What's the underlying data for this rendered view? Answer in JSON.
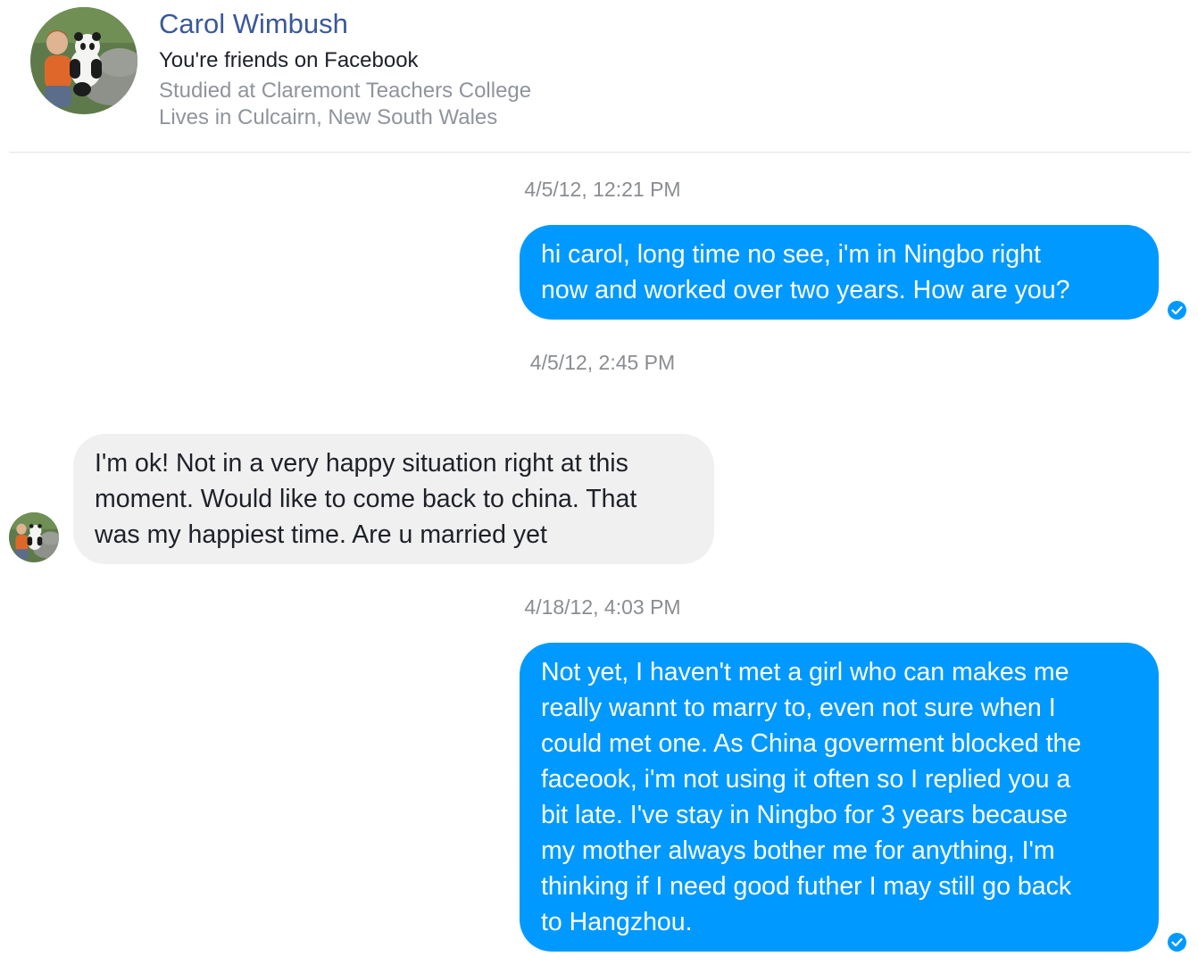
{
  "profile": {
    "name": "Carol Wimbush",
    "friend_status": "You're friends on Facebook",
    "education": "Studied at Claremont Teachers College",
    "location": "Lives in Culcairn, New South Wales"
  },
  "conversation": {
    "messages": [
      {
        "timestamp": "4/5/12, 12:21 PM",
        "direction": "outgoing",
        "lines": [
          "hi carol, long time no see, i'm in Ningbo right",
          "now and worked over two years. How are you?"
        ],
        "seen_icon": "seen-check-icon"
      },
      {
        "timestamp": "4/5/12, 2:45 PM",
        "direction": "incoming",
        "lines": [
          "I'm ok! Not in a very happy situation right at this",
          "moment. Would like to come back to china. That",
          "was my happiest time. Are u married yet"
        ]
      },
      {
        "timestamp": "4/18/12, 4:03 PM",
        "direction": "outgoing",
        "lines": [
          "Not yet, I haven't met a girl who can makes me",
          "really wannt to marry to, even not sure when I",
          "could met one. As China goverment blocked the",
          "faceook, i'm not using it often so I replied you a",
          "bit late. I've stay in Ningbo for 3 years because",
          "my mother always bother me for anything, I'm",
          "thinking if I need good futher I may still go back",
          "to Hangzhou."
        ],
        "seen_icon": "seen-check-icon"
      }
    ]
  },
  "colors": {
    "outgoing_bubble": "#0099ff",
    "incoming_bubble": "#f1f0f0",
    "name_link": "#3b5998",
    "secondary_text": "#90949c"
  }
}
